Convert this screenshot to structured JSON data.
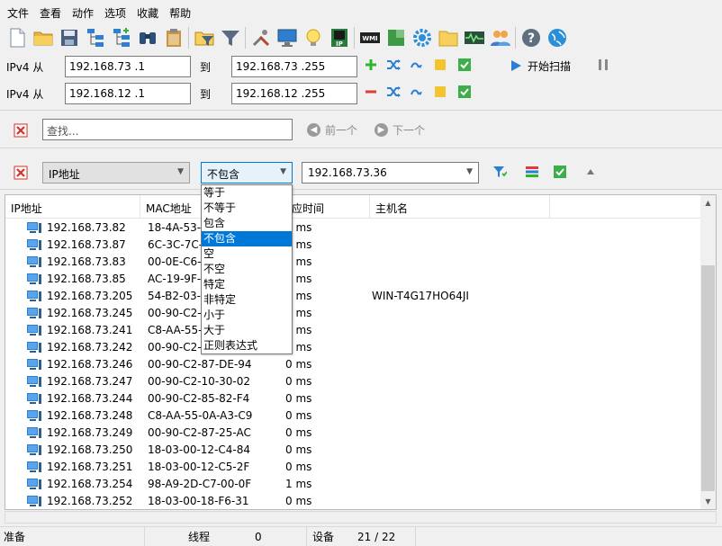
{
  "menu": [
    "文件",
    "查看",
    "动作",
    "选项",
    "收藏",
    "帮助"
  ],
  "toolbar_icons": [
    "new-file-icon",
    "open-folder-icon",
    "save-icon",
    "network-tree-icon",
    "add-network-icon",
    "binoculars-icon",
    "clipboard-icon",
    "sep",
    "filter-folder-icon",
    "filter-icon",
    "sep",
    "tools-icon",
    "monitor-icon",
    "lightbulb-icon",
    "ip-card-icon",
    "sep",
    "wmi-icon",
    "green-cube-icon",
    "gear-icon",
    "folder-icon",
    "oscilloscope-icon",
    "users-icon",
    "sep",
    "help-icon",
    "globe-icon"
  ],
  "toolbar_texts": {
    "ip_card": "IP",
    "wmi": "WMI"
  },
  "ranges": [
    {
      "label": "IPv4 从",
      "from": "192.168.73 .1",
      "to_label": "到",
      "to": "192.168.73 .255",
      "action": "add"
    },
    {
      "label": "IPv4 从",
      "from": "192.168.12 .1",
      "to_label": "到",
      "to": "192.168.12 .255",
      "action": "remove"
    }
  ],
  "scan_button": "开始扫描",
  "search": {
    "placeholder": "查找...",
    "prev": "前一个",
    "next": "下一个"
  },
  "filter": {
    "field": "IP地址",
    "condition": "不包含",
    "value": "192.168.73.36",
    "options": [
      "等于",
      "不等于",
      "包含",
      "不包含",
      "空",
      "不空",
      "特定",
      "非特定",
      "小于",
      "大于",
      "正则表达式"
    ],
    "selected_index": 3
  },
  "columns": {
    "ip": "IP地址",
    "mac": "MAC地址",
    "rt": "响应时间",
    "host": "主机名"
  },
  "rows": [
    {
      "ip": "192.168.73.82",
      "mac": "18-4A-53-",
      "rt": "0 ms",
      "host": ""
    },
    {
      "ip": "192.168.73.87",
      "mac": "6C-3C-7C-",
      "rt": "0 ms",
      "host": ""
    },
    {
      "ip": "192.168.73.83",
      "mac": "00-0E-C6-",
      "rt": "0 ms",
      "host": ""
    },
    {
      "ip": "192.168.73.85",
      "mac": "AC-19-9F-",
      "rt": "5 ms",
      "host": ""
    },
    {
      "ip": "192.168.73.205",
      "mac": "54-B2-03-",
      "rt": "0 ms",
      "host": "WIN-T4G17HO64JI"
    },
    {
      "ip": "192.168.73.245",
      "mac": "00-90-C2-",
      "rt": "0 ms",
      "host": ""
    },
    {
      "ip": "192.168.73.241",
      "mac": "C8-AA-55-",
      "rt": "0 ms",
      "host": ""
    },
    {
      "ip": "192.168.73.242",
      "mac": "00-90-C2-",
      "rt": "0 ms",
      "host": ""
    },
    {
      "ip": "192.168.73.246",
      "mac": "00-90-C2-87-DE-94",
      "rt": "0 ms",
      "host": ""
    },
    {
      "ip": "192.168.73.247",
      "mac": "00-90-C2-10-30-02",
      "rt": "0 ms",
      "host": ""
    },
    {
      "ip": "192.168.73.244",
      "mac": "00-90-C2-85-82-F4",
      "rt": "0 ms",
      "host": ""
    },
    {
      "ip": "192.168.73.248",
      "mac": "C8-AA-55-0A-A3-C9",
      "rt": "0 ms",
      "host": ""
    },
    {
      "ip": "192.168.73.249",
      "mac": "00-90-C2-87-25-AC",
      "rt": "0 ms",
      "host": ""
    },
    {
      "ip": "192.168.73.250",
      "mac": "18-03-00-12-C4-84",
      "rt": "0 ms",
      "host": ""
    },
    {
      "ip": "192.168.73.251",
      "mac": "18-03-00-12-C5-2F",
      "rt": "0 ms",
      "host": ""
    },
    {
      "ip": "192.168.73.254",
      "mac": "98-A9-2D-C7-00-0F",
      "rt": "1 ms",
      "host": ""
    },
    {
      "ip": "192.168.73.252",
      "mac": "18-03-00-18-F6-31",
      "rt": "0 ms",
      "host": ""
    }
  ],
  "status": {
    "ready": "准备",
    "threads_label": "线程",
    "threads": "0",
    "devices_label": "设备",
    "devices": "21 / 22"
  },
  "colors": {
    "accent": "#0078d7",
    "add": "#2db52d",
    "remove": "#e03a3a",
    "close": "#d93025",
    "host_icon": "#2f7fd0"
  }
}
